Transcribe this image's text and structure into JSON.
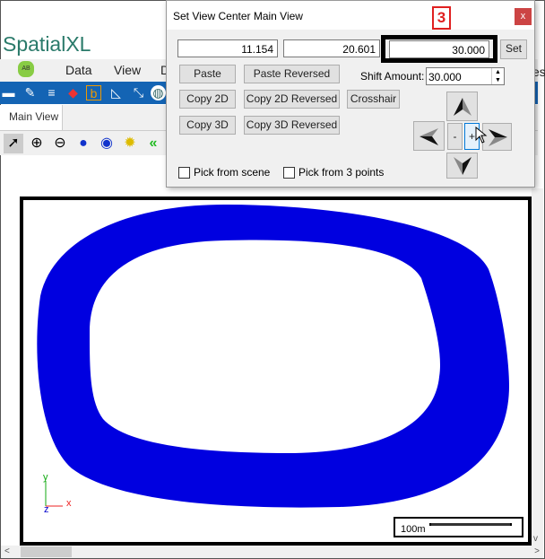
{
  "app": {
    "title": "SpatialXL",
    "menu": [
      "Data",
      "View",
      "D"
    ],
    "menu_right_partial": "es",
    "tab": "Main View"
  },
  "toolbar_icons": [
    "pointer-icon",
    "zoom-in-icon",
    "zoom-out-icon",
    "globe-icon",
    "globe-grid-icon",
    "gear-icon",
    "double-chevron-left-icon"
  ],
  "dialog": {
    "title": "Set View Center Main View",
    "close": "x",
    "step_marker": "3",
    "x": "11.154",
    "y": "20.601",
    "z": "30.000",
    "set": "Set",
    "paste": "Paste",
    "paste_rev": "Paste Reversed",
    "copy2d": "Copy 2D",
    "copy2d_rev": "Copy 2D Reversed",
    "crosshair": "Crosshair",
    "copy3d": "Copy 3D",
    "copy3d_rev": "Copy 3D Reversed",
    "shift_label": "Shift Amount:",
    "shift_value": "30.000",
    "minus": "-",
    "plus": "+",
    "pick_scene": "Pick from scene",
    "pick_3pts": "Pick from 3 points"
  },
  "viewport": {
    "axes": {
      "x": "x",
      "y": "y",
      "z": "z"
    },
    "scale": "100m",
    "fill_color": "#0000e0"
  }
}
